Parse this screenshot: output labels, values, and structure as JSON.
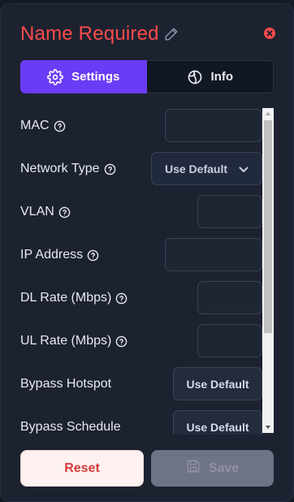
{
  "dialog": {
    "title": "Name Required",
    "title_color": "#ff4b4b",
    "accent_color": "#6b3cf6"
  },
  "tabs": [
    {
      "label": "Settings",
      "icon": "gear-icon",
      "active": true
    },
    {
      "label": "Info",
      "icon": "globe-icon",
      "active": false
    }
  ],
  "fields": {
    "mac": {
      "label": "MAC",
      "value": ""
    },
    "network_type": {
      "label": "Network Type",
      "value": "Use Default"
    },
    "vlan": {
      "label": "VLAN",
      "value": ""
    },
    "ip_address": {
      "label": "IP Address",
      "value": ""
    },
    "dl_rate": {
      "label": "DL Rate (Mbps)",
      "value": ""
    },
    "ul_rate": {
      "label": "UL Rate (Mbps)",
      "value": ""
    },
    "bypass_hotspot": {
      "label": "Bypass Hotspot",
      "value": "Use Default"
    },
    "bypass_schedule": {
      "label": "Bypass Schedule",
      "value": "Use Default"
    }
  },
  "footer": {
    "reset_label": "Reset",
    "save_label": "Save"
  }
}
